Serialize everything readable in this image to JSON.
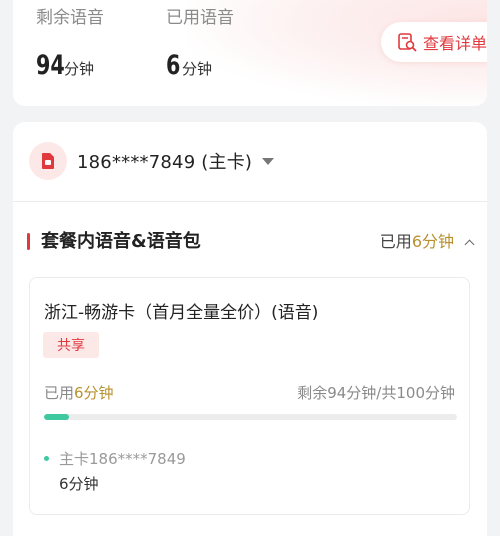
{
  "summary": {
    "remaining_label": "剩余语音",
    "remaining_value": "94",
    "remaining_unit": "分钟",
    "used_label": "已用语音",
    "used_value": "6",
    "used_unit": "分钟",
    "detail_button": "查看详单",
    "detail_icon": "search-document-icon"
  },
  "account": {
    "number": "186****7849 (主卡)",
    "icon": "sim-card-icon"
  },
  "section": {
    "title": "套餐内语音&语音包",
    "used_prefix": "已用",
    "used_value": "6分钟"
  },
  "plan": {
    "name": "浙江-畅游卡（首月全量全价）(语音)",
    "tag": "共享",
    "used_prefix": "已用",
    "used_value": "6分钟",
    "remaining_text": "剩余94分钟/共100分钟",
    "progress_fraction": 0.06,
    "member_label": "主卡186****7849",
    "member_usage": "6分钟"
  },
  "colors": {
    "accent": "#e0393e",
    "gold": "#b8912f",
    "progress": "#3ec9a0"
  }
}
